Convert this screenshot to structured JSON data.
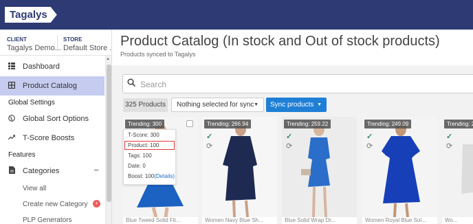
{
  "app": {
    "logo_text": "Tagalys",
    "brand_color": "#2e3a73",
    "accent": "#1f7fd6",
    "active_bg": "#c5ccef"
  },
  "context": {
    "client_label": "CLIENT",
    "client_value": "Tagalys Demo...",
    "store_label": "STORE",
    "store_value": "Default Store ..."
  },
  "sidebar": {
    "dashboard": {
      "label": "Dashboard",
      "icon": "dashboard-icon"
    },
    "product_catalog": {
      "label": "Product Catalog",
      "icon": "grid-icon"
    },
    "global_settings": "Global Settings",
    "global_sort": {
      "label": "Global Sort Options",
      "icon": "globe-icon"
    },
    "tscore": {
      "label": "T-Score Boosts",
      "icon": "trending-icon"
    },
    "features": "Features",
    "categories": {
      "label": "Categories",
      "icon": "document-icon",
      "toggle": "−"
    },
    "view_all": "View all",
    "create_category": {
      "label": "Create new Category",
      "badge": "+"
    },
    "plp_generators": "PLP Generators"
  },
  "header": {
    "title": "Product Catalog (In stock and Out of stock products)",
    "subtitle": "Products synced to Tagalys"
  },
  "search": {
    "placeholder": "Search",
    "icon": "search-icon"
  },
  "toolbar": {
    "count": "325 Products",
    "selection": "Nothing selected for sync",
    "sync_button": "Sync products"
  },
  "cards": [
    {
      "trending": "Trending: 300",
      "strip": "Blue Tweed Solid Fit..."
    },
    {
      "trending": "Trending: 266.94",
      "strip": "Women Navy Blue Sh..."
    },
    {
      "trending": "Trending: 259.22",
      "strip": "Blue Solid Wrap Dr..."
    },
    {
      "trending": "Trending: 249.09",
      "strip": "Women Royal Blue Sol..."
    },
    {
      "trending": "Trending: 2",
      "strip": "Wo..."
    }
  ],
  "popup": {
    "tscore": "T-Score: 300",
    "product": "Product: 100",
    "tags": "Tags: 100",
    "date": "Date: 0",
    "boost_prefix": "Boost: 100",
    "details": "(Details)"
  }
}
